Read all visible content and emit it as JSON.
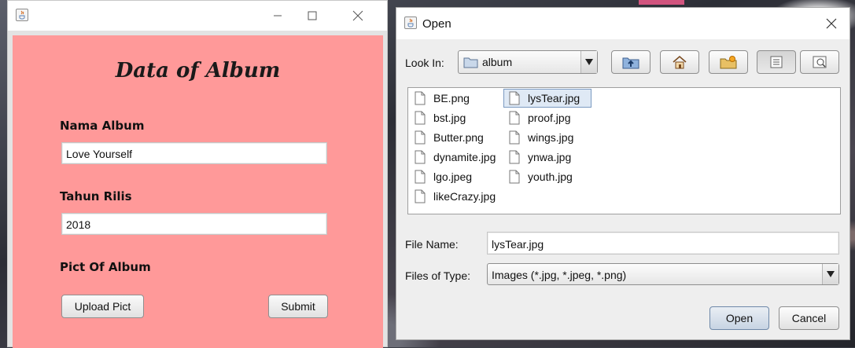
{
  "main_window": {
    "heading": "Data of Album",
    "nama_album_label": "Nama Album",
    "nama_album_value": "Love Yourself",
    "tahun_rilis_label": "Tahun Rilis",
    "tahun_rilis_value": "2018",
    "pict_label": "Pict Of Album",
    "upload_button": "Upload Pict",
    "submit_button": "Submit",
    "panel_color": "#ff9999"
  },
  "open_dialog": {
    "title": "Open",
    "look_in_label": "Look In:",
    "look_in_value": "album",
    "toolbar_icons": [
      "up-folder-icon",
      "home-icon",
      "new-folder-icon",
      "list-view-icon",
      "details-view-icon"
    ],
    "files": [
      "BE.png",
      "bst.jpg",
      "Butter.png",
      "dynamite.jpg",
      "lgo.jpeg",
      "likeCrazy.jpg",
      "lysTear.jpg",
      "proof.jpg",
      "wings.jpg",
      "ynwa.jpg",
      "youth.jpg"
    ],
    "selected_file": "lysTear.jpg",
    "file_name_label": "File Name:",
    "file_name_value": "lysTear.jpg",
    "file_type_label": "Files of Type:",
    "file_type_value": "Images (*.jpg, *.jpeg, *.png)",
    "open_button": "Open",
    "cancel_button": "Cancel"
  }
}
